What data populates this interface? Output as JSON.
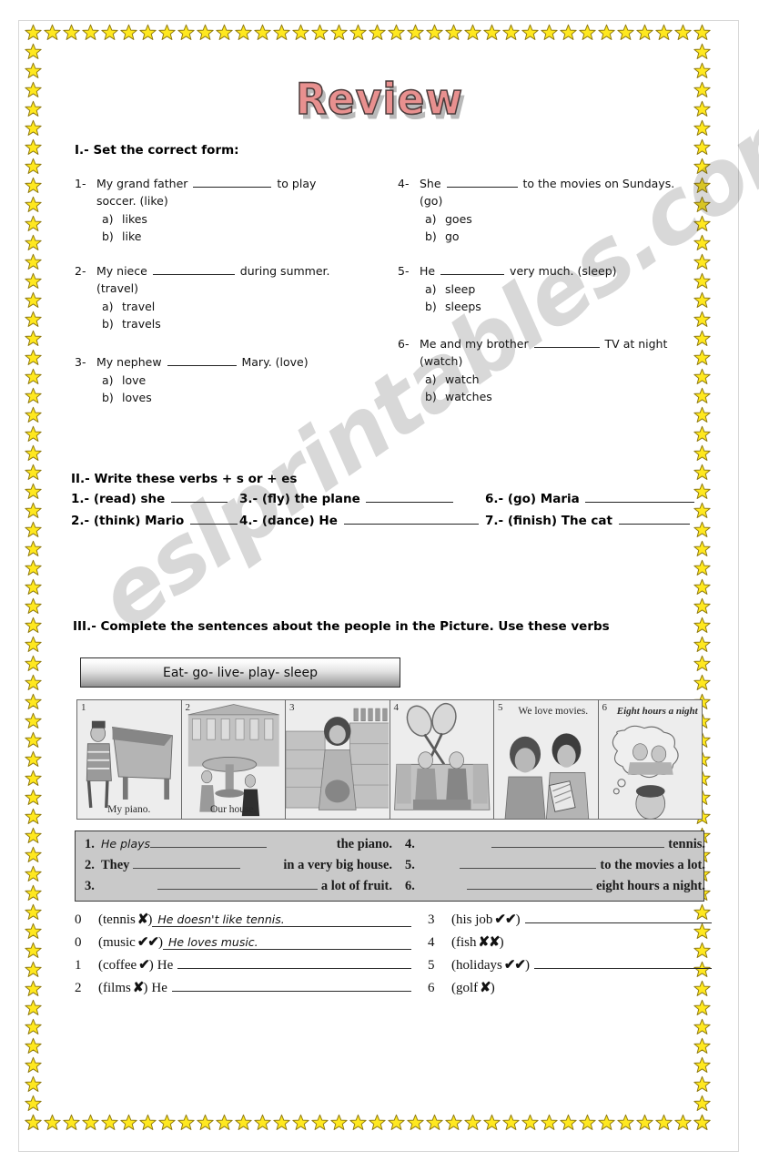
{
  "title": "Review",
  "watermark": "eslprintables.com",
  "section1": {
    "heading": "I.- Set the correct form:",
    "items": [
      {
        "num": "1-",
        "pre": "My grand father",
        "mid": "to play",
        "line2": "soccer. (like)",
        "options": [
          {
            "key": "a)",
            "text": "likes"
          },
          {
            "key": "b)",
            "text": "like"
          }
        ]
      },
      {
        "num": "2-",
        "pre": "My niece",
        "mid": "during summer.",
        "line2": "(travel)",
        "options": [
          {
            "key": "a)",
            "text": "travel"
          },
          {
            "key": "b)",
            "text": "travels"
          }
        ]
      },
      {
        "num": "3-",
        "pre": "My nephew",
        "mid": "Mary. (love)",
        "line2": "",
        "options": [
          {
            "key": "a)",
            "text": "love"
          },
          {
            "key": "b)",
            "text": "loves"
          }
        ]
      },
      {
        "num": "4-",
        "pre": "She",
        "mid": "to the movies on Sundays.",
        "line2": "(go)",
        "options": [
          {
            "key": "a)",
            "text": "goes"
          },
          {
            "key": "b)",
            "text": "go"
          }
        ]
      },
      {
        "num": "5-",
        "pre": "He",
        "mid": "very much. (sleep)",
        "line2": "",
        "options": [
          {
            "key": "a)",
            "text": "sleep"
          },
          {
            "key": "b)",
            "text": "sleeps"
          }
        ]
      },
      {
        "num": "6-",
        "pre": "Me and my brother",
        "mid": "TV at night",
        "line2": "(watch)",
        "options": [
          {
            "key": "a)",
            "text": "watch"
          },
          {
            "key": "b)",
            "text": "watches"
          }
        ]
      }
    ]
  },
  "section2": {
    "heading": "II.- Write these verbs + s or + es",
    "items": [
      {
        "num": "1.-",
        "text": "(read) she"
      },
      {
        "num": "2.-",
        "text": "(think) Mario"
      },
      {
        "num": "3.-",
        "text": "(fly) the plane"
      },
      {
        "num": "4.-",
        "text": "(dance) He"
      },
      {
        "num": "6.-",
        "text": "(go) Maria"
      },
      {
        "num": "7.-",
        "text": "(finish) The cat"
      }
    ]
  },
  "section3": {
    "heading": "III.- Complete the sentences about the people in the Picture. Use these verbs",
    "verb_box": "Eat- go- live- play- sleep",
    "panels": [
      {
        "num": "1",
        "caption": "My piano.",
        "caption_pos": "bottom"
      },
      {
        "num": "2",
        "caption": "Our house.",
        "caption_pos": "bottom"
      },
      {
        "num": "3",
        "caption": "",
        "caption_pos": "none"
      },
      {
        "num": "4",
        "caption": "",
        "caption_pos": "none"
      },
      {
        "num": "5",
        "caption": "We love movies.",
        "caption_pos": "top"
      },
      {
        "num": "6",
        "caption": "Eight hours a night",
        "caption_pos": "top-italic"
      }
    ],
    "answers": [
      {
        "num": "1.",
        "written": "He plays",
        "pre": "",
        "tail": "the piano."
      },
      {
        "num": "2.",
        "written": "",
        "pre": "They",
        "tail": "in a very big house."
      },
      {
        "num": "3.",
        "written": "",
        "pre": "",
        "tail": "a lot of fruit."
      },
      {
        "num": "4.",
        "written": "",
        "pre": "",
        "tail": "tennis."
      },
      {
        "num": "5.",
        "written": "",
        "pre": "",
        "tail": "to the movies a lot."
      },
      {
        "num": "6.",
        "written": "",
        "pre": "",
        "tail": "eight hours a night."
      }
    ]
  },
  "bottom_exercise": {
    "items": [
      {
        "num": "0",
        "tag": "(tennis",
        "mark": "✘",
        "close": ")",
        "pre": "",
        "written": "He doesn't like tennis.",
        "has_line": true
      },
      {
        "num": "0",
        "tag": "(music",
        "mark": "✔✔",
        "close": ")",
        "pre": "",
        "written": "He loves music.",
        "has_line": true
      },
      {
        "num": "1",
        "tag": "(coffee",
        "mark": "✔",
        "close": ")",
        "pre": "He",
        "written": "",
        "has_line": true
      },
      {
        "num": "2",
        "tag": "(films",
        "mark": "✘",
        "close": ")",
        "pre": "He",
        "written": "",
        "has_line": true
      },
      {
        "num": "3",
        "tag": "(his job",
        "mark": "✔✔",
        "close": ")",
        "pre": "",
        "written": "",
        "has_line": true
      },
      {
        "num": "4",
        "tag": "(fish",
        "mark": "✘✘",
        "close": ")",
        "pre": "",
        "written": "",
        "has_line": false
      },
      {
        "num": "5",
        "tag": "(holidays",
        "mark": "✔✔",
        "close": ")",
        "pre": "",
        "written": "",
        "has_line": true
      },
      {
        "num": "6",
        "tag": "(golf",
        "mark": "✘",
        "close": ")",
        "pre": "",
        "written": "",
        "has_line": false
      }
    ]
  },
  "colors": {
    "star": "#ffe81f",
    "star_outline": "#8f7a10",
    "title_fill": "#e8908f",
    "table_bg": "#c9c9c9",
    "strip_bg": "#e9e9e9"
  }
}
